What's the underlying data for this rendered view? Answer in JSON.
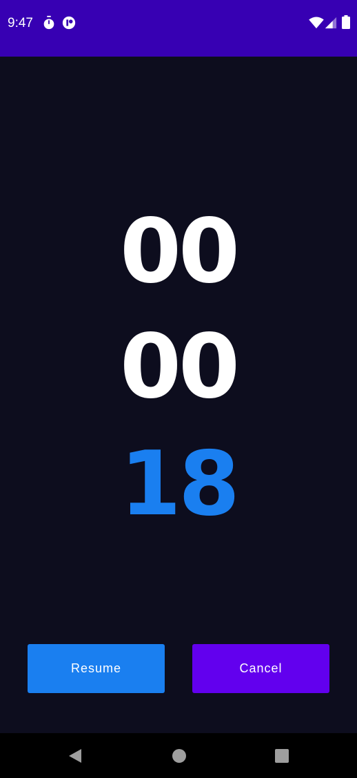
{
  "status_bar": {
    "time": "9:47",
    "icons": [
      "stopwatch-icon",
      "app-notification-icon",
      "wifi-icon",
      "signal-icon",
      "battery-icon"
    ],
    "background": "#3700b3"
  },
  "timer": {
    "hours": "00",
    "minutes": "00",
    "seconds": "18",
    "digit_color": "#ffffff",
    "active_color": "#1a7ff0"
  },
  "buttons": {
    "resume_label": "Resume",
    "cancel_label": "Cancel",
    "resume_color": "#1a7ff0",
    "cancel_color": "#6200ee"
  },
  "nav_bar": {
    "icons": [
      "back-icon",
      "home-icon",
      "recents-icon"
    ]
  },
  "colors": {
    "background": "#0d0d1e"
  }
}
